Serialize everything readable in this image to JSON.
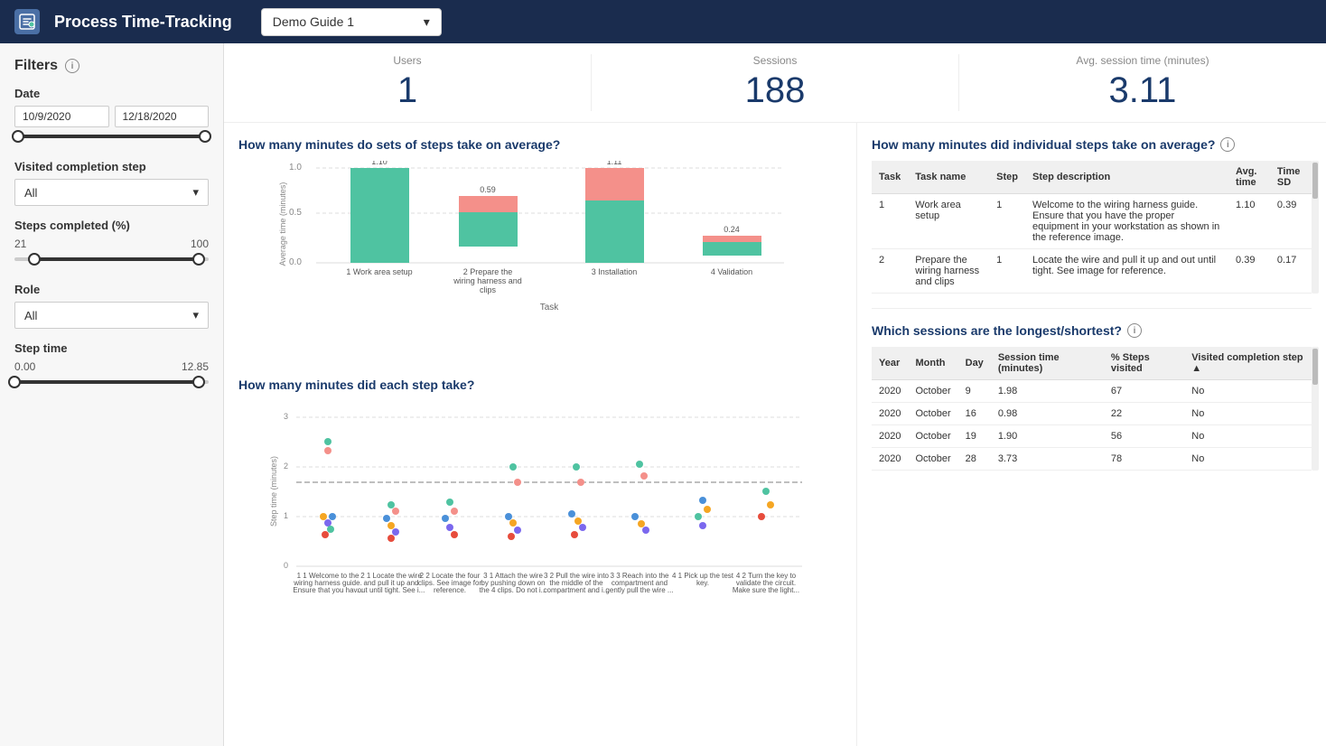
{
  "header": {
    "title": "Process Time-Tracking",
    "dropdown_value": "Demo Guide 1",
    "icon": "⏱"
  },
  "filters": {
    "title": "Filters",
    "date": {
      "label": "Date",
      "start": "10/9/2020",
      "end": "12/18/2020"
    },
    "visited_completion_step": {
      "label": "Visited completion step",
      "value": "All"
    },
    "steps_completed": {
      "label": "Steps completed (%)",
      "min": "21",
      "max": "100"
    },
    "role": {
      "label": "Role",
      "value": "All"
    },
    "step_time": {
      "label": "Step time",
      "min": "0.00",
      "max": "12.85"
    }
  },
  "stats": {
    "users": {
      "label": "Users",
      "value": "1"
    },
    "sessions": {
      "label": "Sessions",
      "value": "188"
    },
    "avg_session_time": {
      "label": "Avg. session time (minutes)",
      "value": "3.11"
    }
  },
  "bar_chart": {
    "title": "How many minutes do sets of steps take on average?",
    "y_axis_label": "Average time (minutes)",
    "x_axis_label": "Task",
    "bars": [
      {
        "label": "1 Work area setup",
        "value": 1.1,
        "teal": 1.1,
        "pink": 0
      },
      {
        "label": "2 Prepare the\nwiring harness and\nclips",
        "value": 0.59,
        "teal": 0.4,
        "pink": 0.19
      },
      {
        "label": "3 Installation",
        "value": 1.11,
        "teal": 0.72,
        "pink": 0.39
      },
      {
        "label": "4 Validation",
        "value": 0.24,
        "teal": 0.16,
        "pink": 0.08
      }
    ]
  },
  "dot_chart": {
    "title": "How many minutes did each step take?",
    "y_axis_label": "Step time (minutes)",
    "steps": [
      {
        "label": "1 1 Welcome to the\nwiring harness guide.\nEnsure that you hav..."
      },
      {
        "label": "2 1 Locate the wire\nand pull it up and\nout until tight. See i..."
      },
      {
        "label": "2 2 Locate the four\nclips. See image for\nreference."
      },
      {
        "label": "3 1 Attach the wire\nby pushing down on\nthe 4 clips. Do not i..."
      },
      {
        "label": "3 2 Pull the wire into\nthe middle of the\ncompartment and i..."
      },
      {
        "label": "3 3 Reach into the\ncompartment and\ngently pull the wire ..."
      },
      {
        "label": "4 1 Pick up the test\nkey."
      },
      {
        "label": "4 2 Turn the key to\nvalidate the circuit.\nMake sure the light..."
      }
    ]
  },
  "steps_table": {
    "title": "How many minutes did individual steps take on average?",
    "columns": [
      "Task",
      "Task name",
      "Step",
      "Step description",
      "Avg. time",
      "Time SD"
    ],
    "rows": [
      {
        "task": "1",
        "task_name": "Work area setup",
        "step": "1",
        "description": "Welcome to the wiring harness guide. Ensure that you have the proper equipment in your workstation as shown in the reference image.",
        "avg_time": "1.10",
        "time_sd": "0.39"
      },
      {
        "task": "2",
        "task_name": "Prepare the wiring harness and clips",
        "step": "1",
        "description": "Locate the wire and pull it up and out until tight. See image for reference.",
        "avg_time": "0.39",
        "time_sd": "0.17"
      }
    ]
  },
  "sessions_table": {
    "title": "Which sessions are the longest/shortest?",
    "columns": [
      "Year",
      "Month",
      "Day",
      "Session time (minutes)",
      "% Steps visited",
      "Visited completion step"
    ],
    "rows": [
      {
        "year": "2020",
        "month": "October",
        "day": "9",
        "session_time": "1.98",
        "steps_visited": "67",
        "completion_step": "No"
      },
      {
        "year": "2020",
        "month": "October",
        "day": "16",
        "session_time": "0.98",
        "steps_visited": "22",
        "completion_step": "No"
      },
      {
        "year": "2020",
        "month": "October",
        "day": "19",
        "session_time": "1.90",
        "steps_visited": "56",
        "completion_step": "No"
      },
      {
        "year": "2020",
        "month": "October",
        "day": "28",
        "session_time": "3.73",
        "steps_visited": "78",
        "completion_step": "No"
      }
    ]
  }
}
